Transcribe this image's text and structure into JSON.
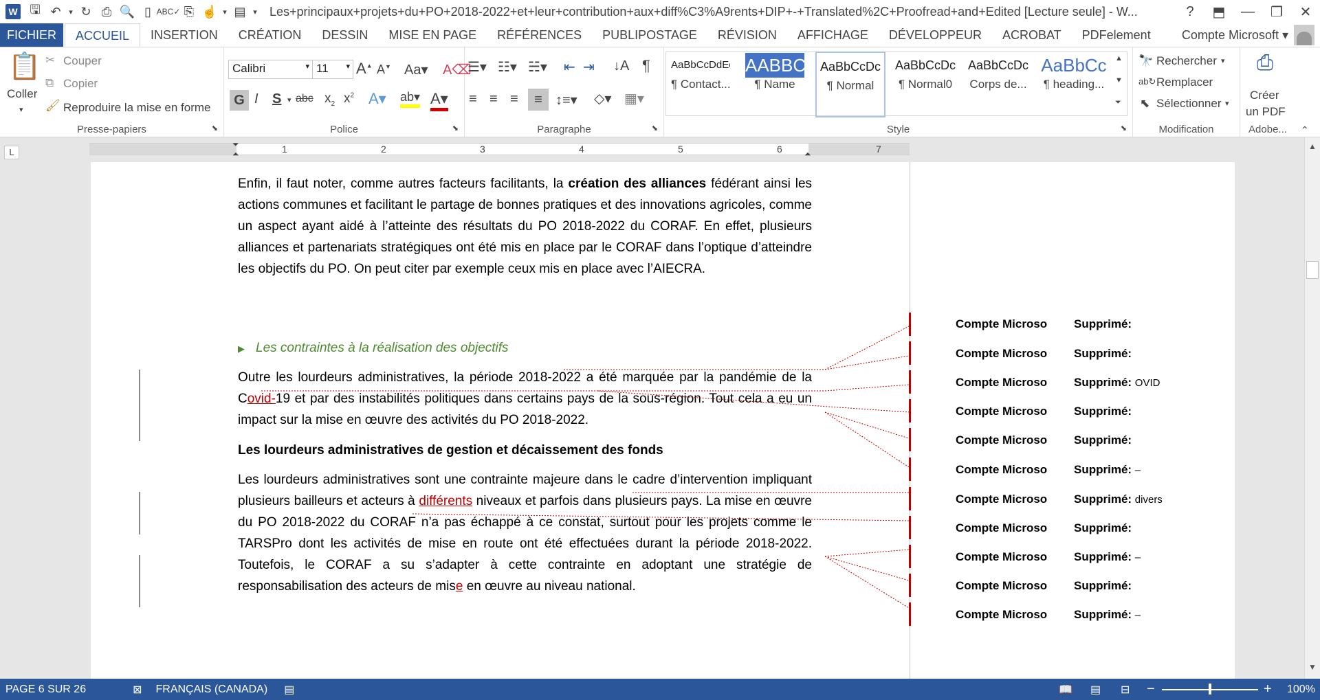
{
  "title_bar": {
    "document_title": "Les+principaux+projets+du+PO+2018-2022+et+leur+contribution+aux+diff%C3%A9rents+DIP+-+Translated%2C+Proofread+and+Edited [Lecture seule] - W...",
    "help": "?",
    "minimize": "—",
    "restore": "❐",
    "close": "✕"
  },
  "menu": {
    "tabs": [
      "FICHIER",
      "ACCUEIL",
      "INSERTION",
      "CRÉATION",
      "DESSIN",
      "MISE EN PAGE",
      "RÉFÉRENCES",
      "PUBLIPOSTAGE",
      "RÉVISION",
      "AFFICHAGE",
      "DÉVELOPPEUR",
      "ACROBAT",
      "PDFelement"
    ],
    "account": "Compte Microsoft ▾"
  },
  "ribbon": {
    "clipboard": {
      "paste": "Coller",
      "cut": "Couper",
      "copy": "Copier",
      "format_painter": "Reproduire la mise en forme",
      "label": "Presse-papiers"
    },
    "font": {
      "font_name": "Calibri",
      "font_size": "11",
      "label": "Police"
    },
    "paragraph": {
      "label": "Paragraphe"
    },
    "styles": {
      "label": "Style",
      "items": [
        {
          "sample": "AaBbCcDdEe",
          "name": "¶ Contact..."
        },
        {
          "sample": "AABBC",
          "name": "¶ Name"
        },
        {
          "sample": "AaBbCcDc",
          "name": "¶ Normal"
        },
        {
          "sample": "AaBbCcDc",
          "name": "¶ Normal0"
        },
        {
          "sample": "AaBbCcDc",
          "name": "Corps de..."
        },
        {
          "sample": "AaBbCc",
          "name": "¶ heading..."
        }
      ]
    },
    "editing": {
      "find": "Rechercher",
      "replace": "Remplacer",
      "select": "Sélectionner",
      "label": "Modification"
    },
    "adobe": {
      "create_pdf_1": "Créer",
      "create_pdf_2": "un PDF",
      "label": "Adobe..."
    }
  },
  "ruler": {
    "numbers": [
      "1",
      "2",
      "3",
      "4",
      "5",
      "6",
      "7"
    ]
  },
  "document": {
    "para1": "l’AIECRA.",
    "section_heading": "Les contraintes à la réalisation des objectifs",
    "para3_heading": "Les lourdeurs administratives de gestion et décaissement des fonds"
  },
  "markup": {
    "author": "Compte Microso",
    "action": "Supprimé:",
    "balloons": [
      "",
      "",
      "OVID",
      "",
      "",
      "–",
      "divers",
      "",
      "–",
      "",
      "–"
    ]
  },
  "status": {
    "page": "PAGE 6 SUR 26",
    "language": "FRANÇAIS (CANADA)",
    "zoom": "100%",
    "zoom_fraction": 0.5
  }
}
